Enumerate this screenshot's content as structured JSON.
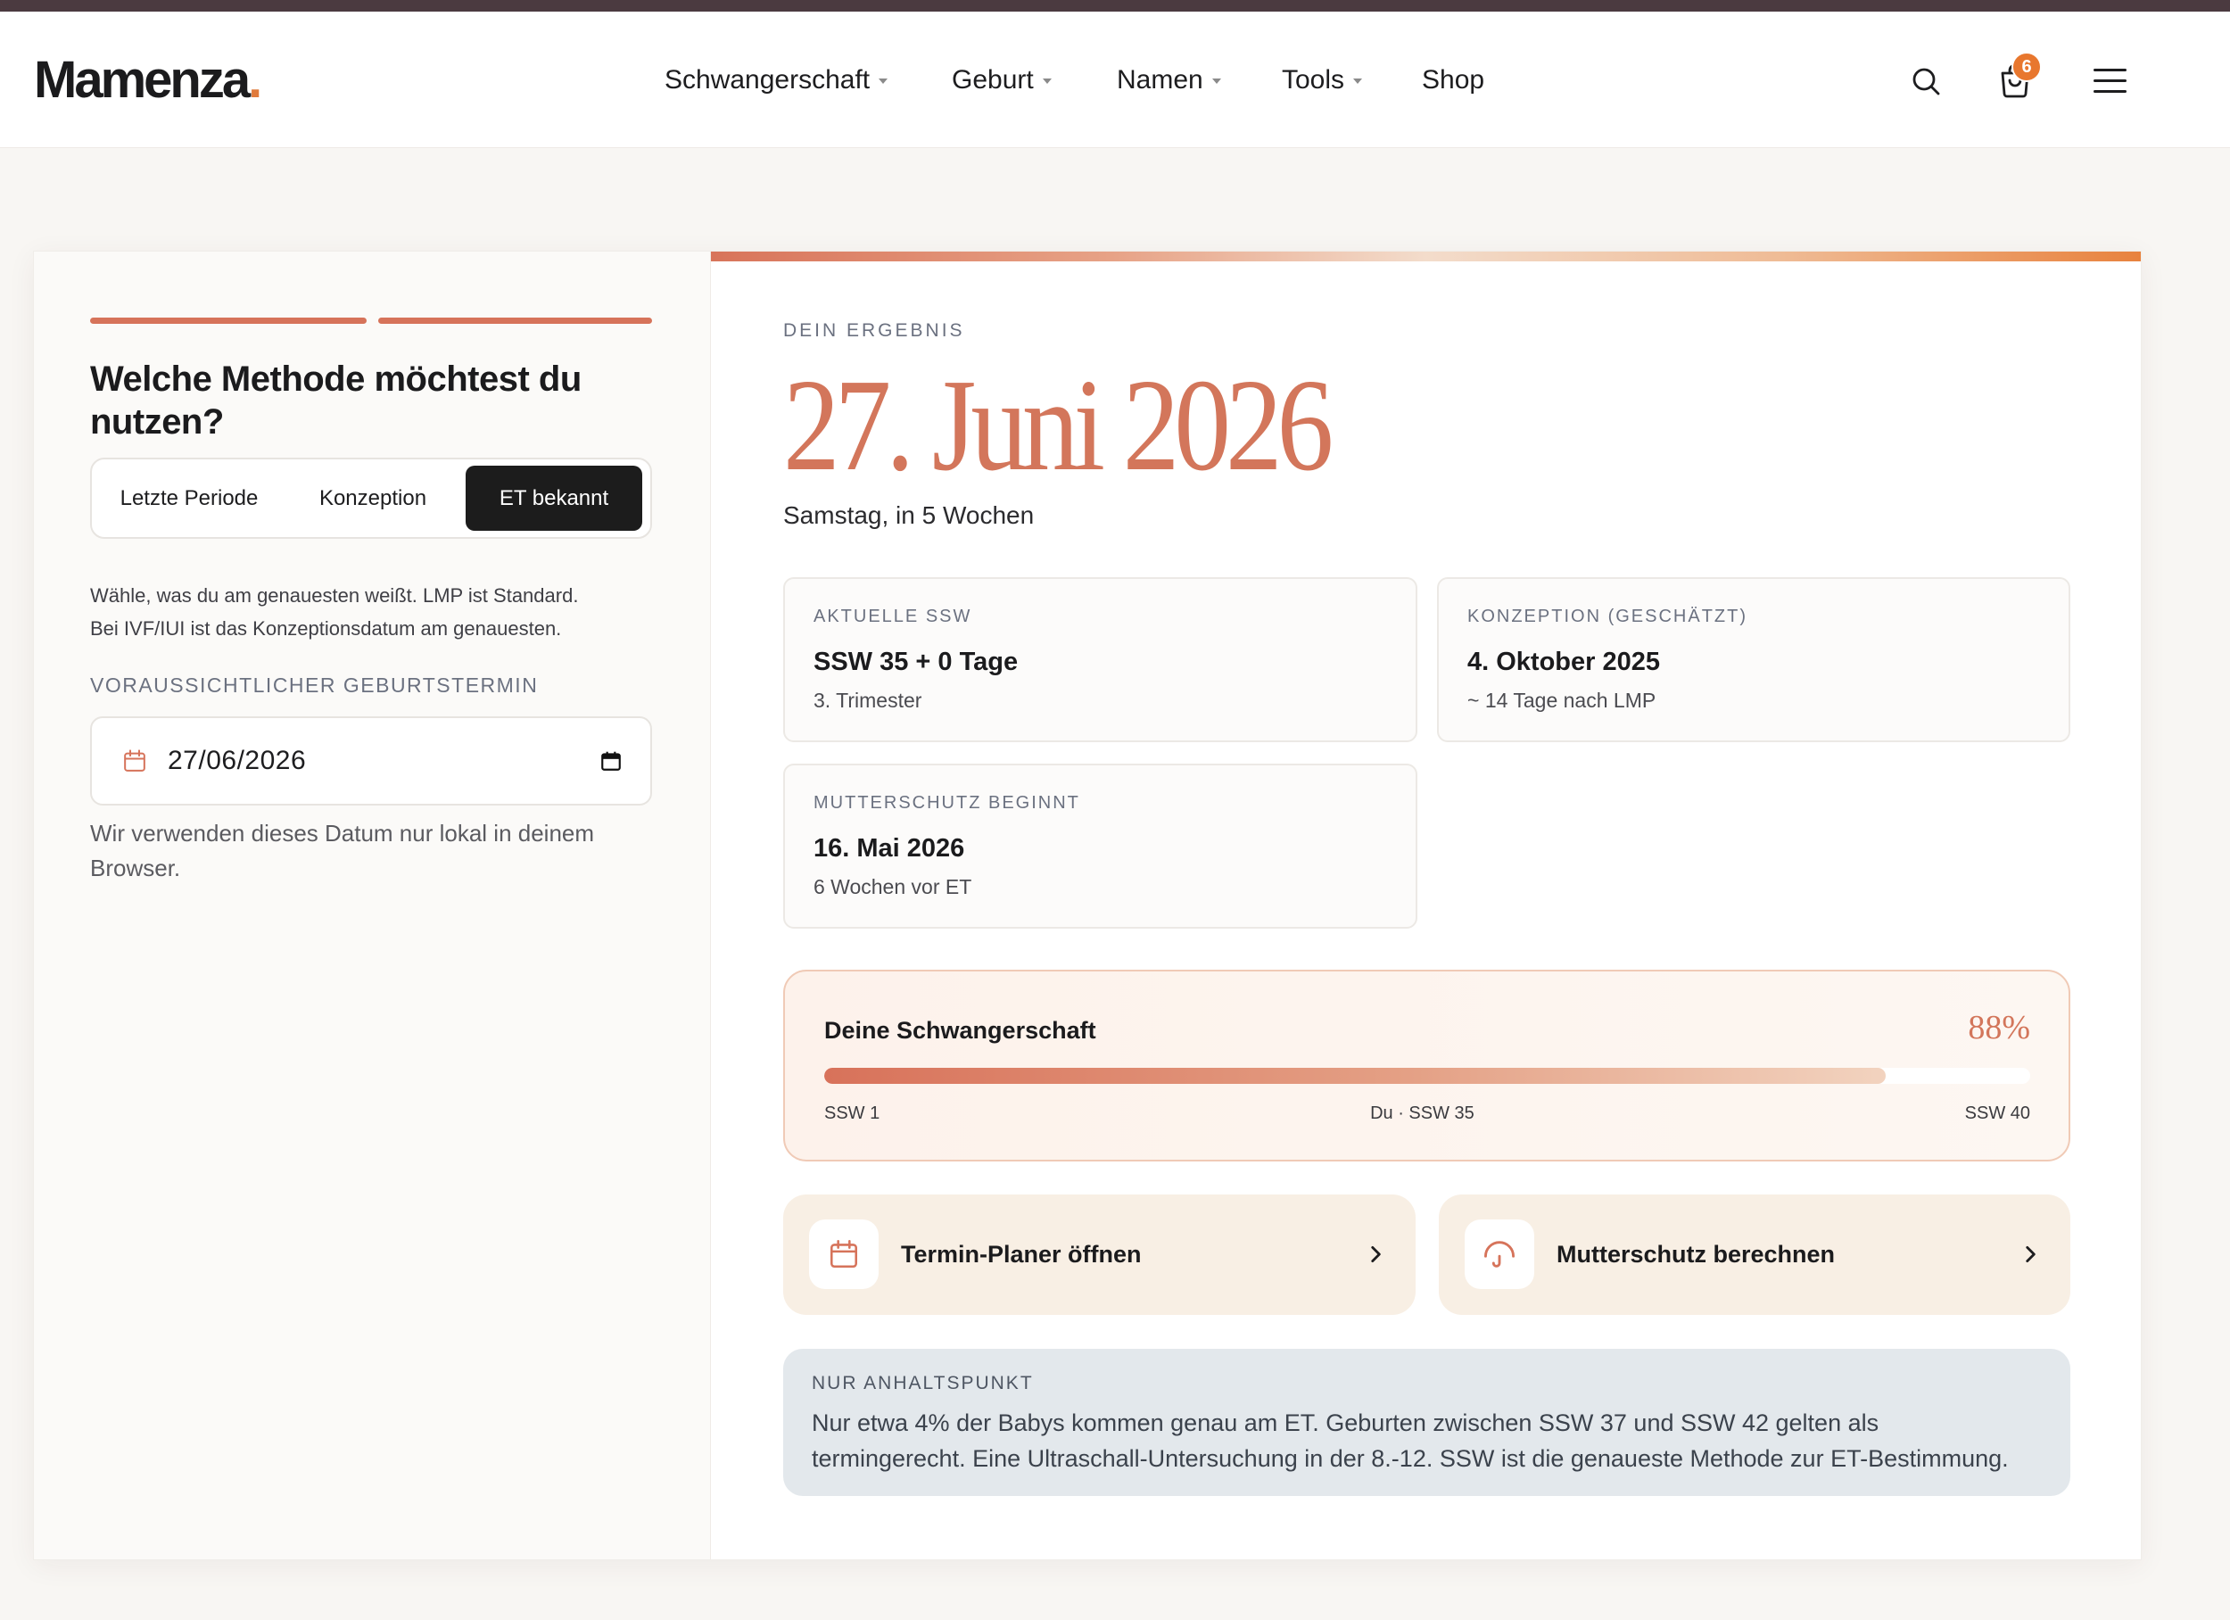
{
  "colors": {
    "topbar": "#4b3a40",
    "accent": "#d6735a",
    "brand_dot": "#e07a3c",
    "badge": "#e8772e",
    "selected_method_bg": "#1c1c1c",
    "info_bg": "#e3e8ec"
  },
  "brand": {
    "name": "Mamenza",
    "dot": "."
  },
  "nav": [
    {
      "label": "Schwangerschaft",
      "dropdown": true
    },
    {
      "label": "Geburt",
      "dropdown": true
    },
    {
      "label": "Namen",
      "dropdown": true
    },
    {
      "label": "Tools",
      "dropdown": true
    },
    {
      "label": "Shop",
      "dropdown": false
    }
  ],
  "header": {
    "search_icon": "search-icon",
    "cart_icon": "shopping-bag-icon",
    "cart_count": "6",
    "menu_icon": "hamburger-menu-icon"
  },
  "form": {
    "steps": {
      "completed": 2,
      "total": 2
    },
    "question": "Welche Methode möchtest du nutzen?",
    "methods": [
      {
        "label": "Letzte Periode",
        "selected": false
      },
      {
        "label": "Konzeption",
        "selected": false
      },
      {
        "label": "ET bekannt",
        "selected": true
      }
    ],
    "hint_lines": [
      "Wähle, was du am genauesten weißt. LMP ist Standard.",
      "Bei IVF/IUI ist das Konzeptionsdatum am genauesten."
    ],
    "date_label": "VORAUSSICHTLICHER GEBURTSTERMIN",
    "date_value": "27/06/2026",
    "date_icon": "calendar-icon",
    "date_picker_icon": "calendar-picker-icon",
    "privacy_note": "Wir verwenden dieses Datum nur lokal in deinem Browser."
  },
  "result": {
    "eyebrow": "DEIN ERGEBNIS",
    "due_date": "27. Juni 2026",
    "due_date_sub": "Samstag, in 5 Wochen",
    "stats": [
      {
        "label": "AKTUELLE SSW",
        "value": "SSW 35 + 0 Tage",
        "sub": "3. Trimester"
      },
      {
        "label": "KONZEPTION (GESCHÄTZT)",
        "value": "4. Oktober 2025",
        "sub": "~ 14 Tage nach LMP"
      },
      {
        "label": "MUTTERSCHUTZ BEGINNT",
        "value": "16. Mai 2026",
        "sub": "6 Wochen vor ET"
      }
    ],
    "progress": {
      "title": "Deine Schwangerschaft",
      "percent_label": "88%",
      "percent": 88,
      "start_label": "SSW 1",
      "current_label": "Du · SSW 35",
      "end_label": "SSW 40"
    },
    "actions": [
      {
        "label": "Termin-Planer öffnen",
        "icon": "calendar-icon"
      },
      {
        "label": "Mutterschutz berechnen",
        "icon": "umbrella-icon"
      }
    ],
    "note": {
      "label": "NUR ANHALTSPUNKT",
      "lines": [
        "Nur etwa 4% der Babys kommen genau am ET. Geburten zwischen SSW 37 und SSW 42 gelten als",
        "termingerecht. Eine Ultraschall-Untersuchung in der 8.-12. SSW ist die genaueste Methode zur ET-Bestimmung."
      ]
    }
  }
}
